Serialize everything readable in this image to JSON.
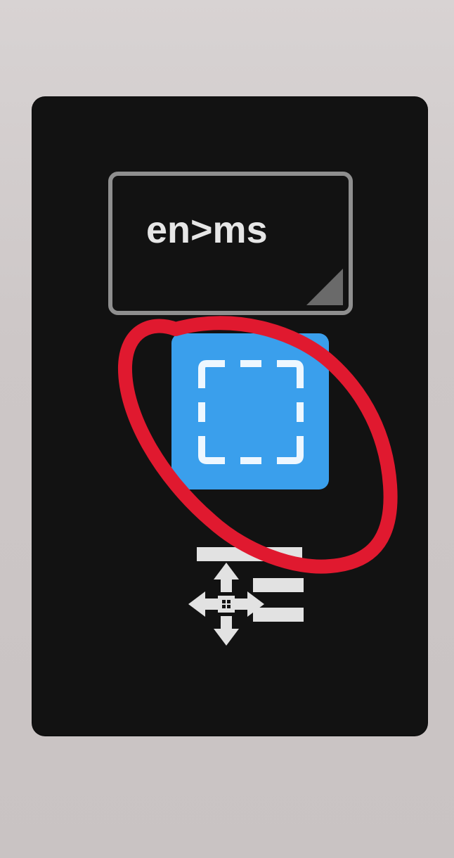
{
  "toolbar": {
    "language_pair_label": "en>ms",
    "language_button_icon": "dropdown-corner-icon",
    "select_area_icon": "dashed-selection-icon",
    "move_icon": "move-drag-icon"
  },
  "colors": {
    "panel_bg": "#121212",
    "select_button_bg": "#3a9fec",
    "annotation_red": "#e0192f",
    "language_button_border": "#8f8f8f"
  }
}
